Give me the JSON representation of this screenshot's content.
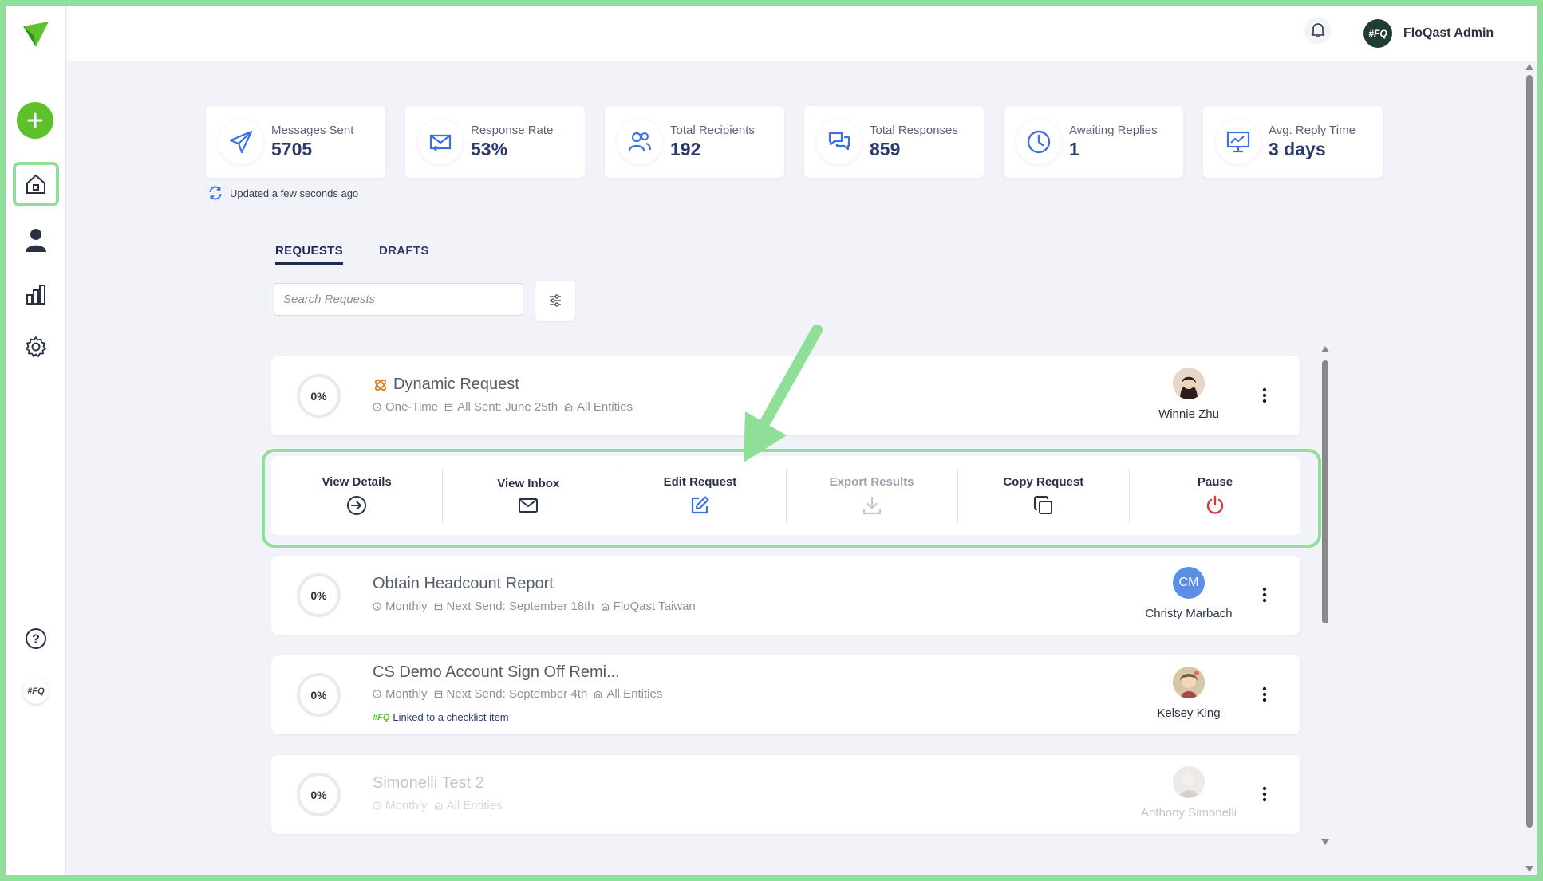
{
  "app": {
    "user_name": "FloQast Admin",
    "user_initials": "#FQ"
  },
  "sidebar": {
    "fq_badge": "#FQ"
  },
  "stats": [
    {
      "label": "Messages Sent",
      "value": "5705",
      "icon": "send-icon"
    },
    {
      "label": "Response Rate",
      "value": "53%",
      "icon": "mail-reply-icon"
    },
    {
      "label": "Total Recipients",
      "value": "192",
      "icon": "users-icon"
    },
    {
      "label": "Total Responses",
      "value": "859",
      "icon": "chat-icon"
    },
    {
      "label": "Awaiting Replies",
      "value": "1",
      "icon": "clock-icon"
    },
    {
      "label": "Avg. Reply Time",
      "value": "3 days",
      "icon": "monitor-chart-icon"
    }
  ],
  "updated_text": "Updated a few seconds ago",
  "tabs": {
    "requests": "REQUESTS",
    "drafts": "DRAFTS"
  },
  "search": {
    "placeholder": "Search Requests",
    "value": ""
  },
  "requests": [
    {
      "progress": "0%",
      "title": "Dynamic Request",
      "frequency": "One-Time",
      "schedule": "All Sent: June 25th",
      "entity": "All Entities",
      "owner": "Winnie Zhu"
    },
    {
      "progress": "0%",
      "title": "Obtain Headcount Report",
      "frequency": "Monthly",
      "schedule": "Next Send: September 18th",
      "entity": "FloQast Taiwan",
      "owner": "Christy Marbach",
      "owner_initials": "CM"
    },
    {
      "progress": "0%",
      "title": "CS Demo Account Sign Off Remi...",
      "frequency": "Monthly",
      "schedule": "Next Send: September 4th",
      "entity": "All Entities",
      "owner": "Kelsey King",
      "linked": "Linked to a checklist item",
      "linked_badge": "#FQ"
    },
    {
      "progress": "0%",
      "title": "Simonelli Test 2",
      "frequency": "Monthly",
      "entity": "All Entities",
      "owner": "Anthony Simonelli"
    }
  ],
  "actions": [
    {
      "label": "View Details",
      "icon": "arrow-circle-right-icon"
    },
    {
      "label": "View Inbox",
      "icon": "envelope-icon"
    },
    {
      "label": "Edit Request",
      "icon": "pencil-edit-icon"
    },
    {
      "label": "Export Results",
      "icon": "download-icon",
      "disabled": true
    },
    {
      "label": "Copy Request",
      "icon": "copy-icon"
    },
    {
      "label": "Pause",
      "icon": "power-icon"
    }
  ],
  "colors": {
    "accent_green": "#5ec12c",
    "highlight_green": "#8fdf98",
    "navy": "#2b3a6b",
    "edit_blue": "#3d6fe0",
    "pause_red": "#d23b3b"
  }
}
